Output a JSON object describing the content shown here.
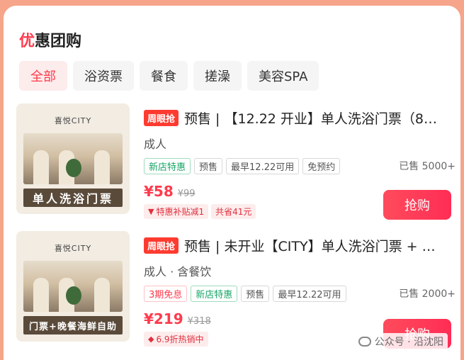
{
  "section": {
    "title_first_char": "优",
    "title_rest": "惠团购"
  },
  "tabs": [
    {
      "label": "全部",
      "active": true
    },
    {
      "label": "浴资票",
      "active": false
    },
    {
      "label": "餐食",
      "active": false
    },
    {
      "label": "搓澡",
      "active": false
    },
    {
      "label": "美容SPA",
      "active": false
    }
  ],
  "items": [
    {
      "badge": "周眼抢",
      "name": "预售 | 【12.22 开业】单人洗浴门票（8…",
      "subtitle": "成人",
      "tags": [
        "新店特惠",
        "预售",
        "最早12.22可用",
        "免预约"
      ],
      "sold": "已售 5000+",
      "price": "¥58",
      "original_price": "¥99",
      "promos": [
        "特惠补贴减1",
        "共省41元"
      ],
      "buy_label": "抢购",
      "thumb_brand": "喜悦CITY",
      "thumb_banner": "单人洗浴门票"
    },
    {
      "badge": "周眼抢",
      "name": "预售 | 未开业【CITY】单人洗浴门票 + …",
      "subtitle": "成人 · 含餐饮",
      "tags": [
        "3期免息",
        "新店特惠",
        "预售",
        "最早12.22可用"
      ],
      "sold": "已售 2000+",
      "price": "¥219",
      "original_price": "¥318",
      "promos": [
        "6.9折热销中"
      ],
      "buy_label": "抢购",
      "thumb_brand": "喜悦CITY",
      "thumb_banner": "门票+晚餐海鲜自助"
    }
  ],
  "watermark": {
    "label": "公众号 · 沿沈阳"
  },
  "colors": {
    "accent": "#ff3b4d",
    "green": "#17a566",
    "background": "#f6a58a"
  }
}
